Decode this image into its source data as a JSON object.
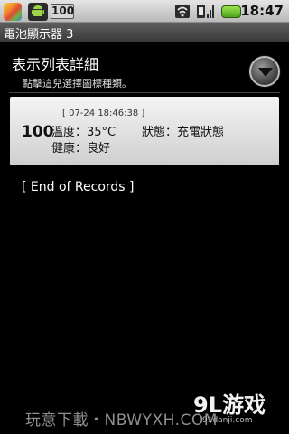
{
  "status_bar": {
    "battery_badge": "100",
    "clock": "18:47",
    "icons": [
      "app-icon",
      "android-icon",
      "battery-level-icon",
      "wifi-icon",
      "signal-icon",
      "battery-icon"
    ],
    "battery_color": "#5fc427"
  },
  "titlebar": {
    "title": "電池顯示器 3"
  },
  "header": {
    "title": "表示列表詳細",
    "subtitle": "點擊這兒選擇圖標種類。",
    "dropdown_icon": "chevron-down-circle-icon"
  },
  "records": [
    {
      "level": "100",
      "timestamp": "[ 07-24 18:46:38 ]",
      "temperature": "溫度：35°C",
      "status": "狀態：充電狀態",
      "health": "健康：良好"
    }
  ],
  "end_label": "[ End of Records ]",
  "watermark": {
    "left_text": "玩意下載・NBWYXH.COM",
    "logo_big": "9L游戏",
    "logo_small": "91danji.com"
  },
  "colors": {
    "accent_bg": "#000000",
    "card_bg": "#e6e6e6",
    "titlebar_bg": "#4a4a4a"
  }
}
